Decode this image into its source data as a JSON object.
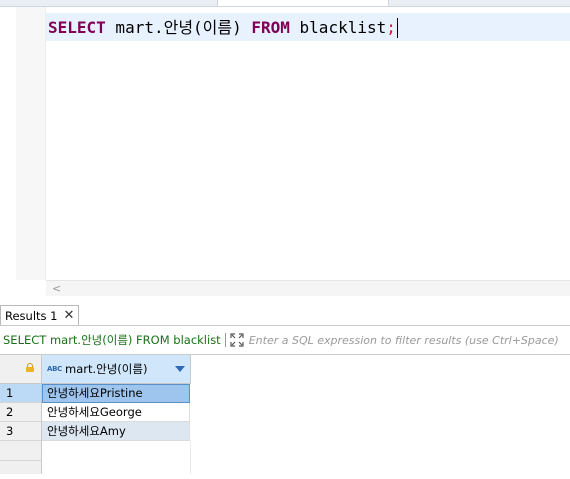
{
  "editor": {
    "select_kw": "SELECT",
    "column_expr": " mart.안녕(이름) ",
    "from_kw": "FROM",
    "table": " blacklist",
    "semicolon": ";",
    "scroll_left_glyph": "<"
  },
  "results": {
    "tab_label": "Results 1",
    "close_glyph": "✕",
    "query_text": "SELECT mart.안녕(이름) FROM blacklist",
    "filter_placeholder": "Enter a SQL expression to filter results (use Ctrl+Space)",
    "column": {
      "type_badge": "ABC",
      "name": "mart.안녕(이름)"
    },
    "rows": [
      {
        "num": "1",
        "value": "안녕하세요Pristine"
      },
      {
        "num": "2",
        "value": "안녕하세요George"
      },
      {
        "num": "3",
        "value": "안녕하세요Amy"
      }
    ]
  },
  "colors": {
    "keyword": "#7f0055",
    "query_green": "#197019",
    "header_blue": "#cfe6fb",
    "selection_blue": "#9ec5ee"
  }
}
